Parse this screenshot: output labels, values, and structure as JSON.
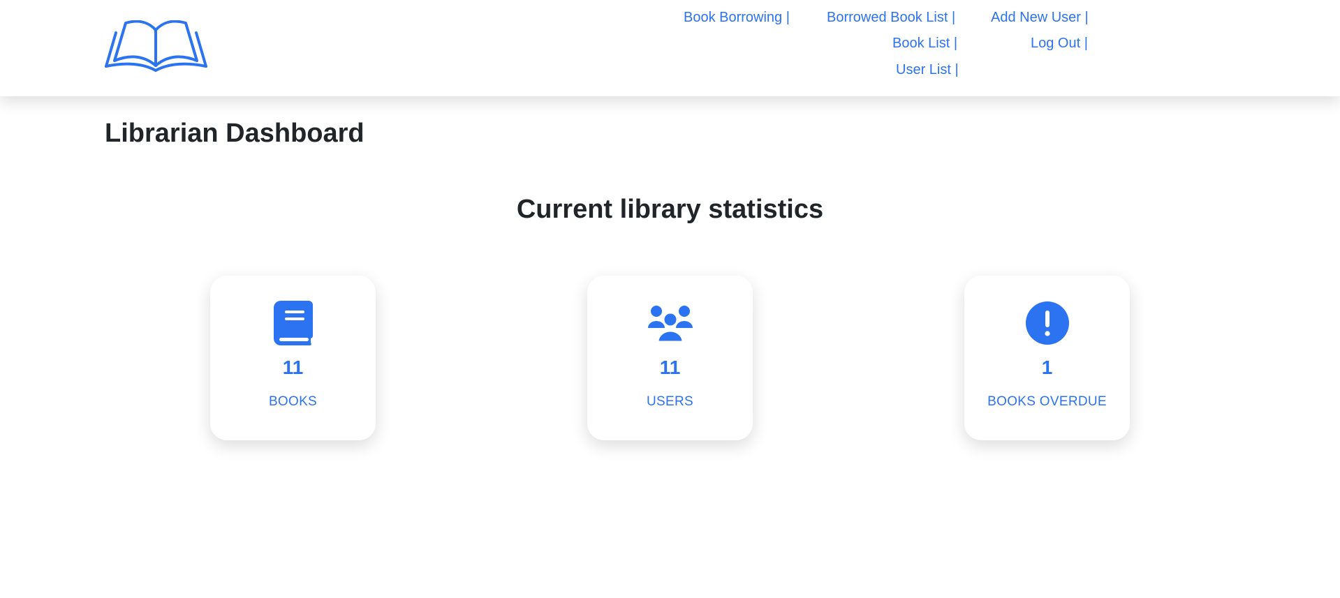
{
  "header": {
    "logo_icon": "open-book-icon",
    "nav": {
      "book_borrowing": "Book Borrowing |",
      "borrowed_book_list": "Borrowed Book List |",
      "book_list": "Book List |",
      "user_list": "User List |",
      "add_new_user": "Add New User |",
      "log_out": "Log Out |"
    }
  },
  "main": {
    "title": "Librarian Dashboard",
    "stats_heading": "Current library statistics",
    "stats": [
      {
        "icon": "book-icon",
        "count": "11",
        "label": "BOOKS"
      },
      {
        "icon": "users-icon",
        "count": "11",
        "label": "USERS"
      },
      {
        "icon": "exclamation-circle-icon",
        "count": "1",
        "label": "BOOKS OVERDUE"
      }
    ]
  },
  "colors": {
    "accent": "#2b73f0",
    "text": "#212529",
    "background": "#ffffff"
  }
}
